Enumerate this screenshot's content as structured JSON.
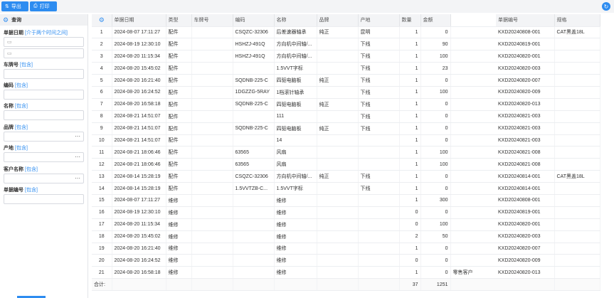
{
  "toolbar": {
    "export_label": "导出",
    "print_label": "打印"
  },
  "filter": {
    "title": "查询",
    "date_label": "单据日期",
    "date_hint": "[介于两个时间之间]",
    "plate_label": "车牌号",
    "plate_hint": "[包含]",
    "code_label": "编码",
    "code_hint": "[包含]",
    "name_label": "名称",
    "name_hint": "[包含]",
    "brand_label": "品牌",
    "brand_hint": "[包含]",
    "origin_label": "产地",
    "origin_hint": "[包含]",
    "customer_label": "客户名称",
    "customer_hint": "[包含]",
    "docno_label": "单据编号",
    "docno_hint": "[包含]"
  },
  "table": {
    "columns": [
      "单据日期",
      "类型",
      "车牌号",
      "编码",
      "名称",
      "品牌",
      "产地",
      "数量",
      "金额",
      "",
      "单据编号",
      "规格"
    ],
    "rows": [
      [
        "1",
        "2024-08-07 17:11:27",
        "配件",
        "",
        "CSQZC-32306",
        "后差速器轴承",
        "纯正",
        "昆明",
        "1",
        "0",
        "",
        "KXD20240808-001",
        "CAT黑盖18L"
      ],
      [
        "2",
        "2024-08-19 12:30:10",
        "配件",
        "",
        "HSHZJ-491Q",
        "方向机中间轴/...",
        "",
        "下线",
        "1",
        "90",
        "",
        "KXD20240819-001",
        ""
      ],
      [
        "3",
        "2024-08-20 11:15:34",
        "配件",
        "",
        "HSHZJ-491Q",
        "方向机中间轴/...",
        "",
        "下线",
        "1",
        "100",
        "",
        "KXD20240820-001",
        ""
      ],
      [
        "4",
        "2024-08-20 15:45:02",
        "配件",
        "",
        "",
        "1.5VVT字标",
        "",
        "下线",
        "1",
        "23",
        "",
        "KXD20240820-003",
        ""
      ],
      [
        "5",
        "2024-08-20 16:21:40",
        "配件",
        "",
        "SQDNB-225-C",
        "四驱电脑板",
        "纯正",
        "下线",
        "1",
        "0",
        "",
        "KXD20240820-007",
        ""
      ],
      [
        "6",
        "2024-08-20 16:24:52",
        "配件",
        "",
        "1DGZZG-5RAY",
        "1档滚针轴承",
        "",
        "下线",
        "1",
        "100",
        "",
        "KXD20240820-009",
        ""
      ],
      [
        "7",
        "2024-08-20 16:58:18",
        "配件",
        "",
        "SQDNB-225-C",
        "四驱电脑板",
        "纯正",
        "下线",
        "1",
        "0",
        "",
        "KXD20240820-013",
        ""
      ],
      [
        "8",
        "2024-08-21 14:51:07",
        "配件",
        "",
        "",
        "111",
        "",
        "下线",
        "1",
        "0",
        "",
        "KXD20240821-003",
        ""
      ],
      [
        "9",
        "2024-08-21 14:51:07",
        "配件",
        "",
        "SQDNB-225-C",
        "四驱电脑板",
        "纯正",
        "下线",
        "1",
        "0",
        "",
        "KXD20240821-003",
        ""
      ],
      [
        "10",
        "2024-08-21 14:51:07",
        "配件",
        "",
        "",
        "14",
        "",
        "",
        "1",
        "0",
        "",
        "KXD20240821-003",
        ""
      ],
      [
        "11",
        "2024-08-21 18:06:46",
        "配件",
        "",
        "63565",
        "风扇",
        "",
        "",
        "1",
        "100",
        "",
        "KXD20240821-008",
        ""
      ],
      [
        "12",
        "2024-08-21 18:06:46",
        "配件",
        "",
        "63565",
        "风扇",
        "",
        "",
        "1",
        "100",
        "",
        "KXD20240821-008",
        ""
      ],
      [
        "13",
        "2024-08-14 15:28:19",
        "配件",
        "",
        "CSQZC-32306",
        "方向机中间轴/...",
        "纯正",
        "下线",
        "1",
        "0",
        "",
        "KXD20240814-001",
        "CAT黑盖18L"
      ],
      [
        "14",
        "2024-08-14 15:28:19",
        "配件",
        "",
        "1.5VVTZB-C...",
        "1.5VVT字标",
        "",
        "下线",
        "1",
        "0",
        "",
        "KXD20240814-001",
        ""
      ],
      [
        "15",
        "2024-08-07 17:11:27",
        "维修",
        "",
        "",
        "维修",
        "",
        "",
        "1",
        "300",
        "",
        "KXD20240808-001",
        ""
      ],
      [
        "16",
        "2024-08-19 12:30:10",
        "维修",
        "",
        "",
        "维修",
        "",
        "",
        "0",
        "0",
        "",
        "KXD20240819-001",
        ""
      ],
      [
        "17",
        "2024-08-20 11:15:34",
        "维修",
        "",
        "",
        "维修",
        "",
        "",
        "0",
        "100",
        "",
        "KXD20240820-001",
        ""
      ],
      [
        "18",
        "2024-08-20 15:45:02",
        "维修",
        "",
        "",
        "维修",
        "",
        "",
        "2",
        "50",
        "",
        "KXD20240820-003",
        ""
      ],
      [
        "19",
        "2024-08-20 16:21:40",
        "维修",
        "",
        "",
        "维修",
        "",
        "",
        "1",
        "0",
        "",
        "KXD20240820-007",
        ""
      ],
      [
        "20",
        "2024-08-20 16:24:52",
        "维修",
        "",
        "",
        "维修",
        "",
        "",
        "0",
        "0",
        "",
        "KXD20240820-009",
        ""
      ],
      [
        "21",
        "2024-08-20 16:58:18",
        "维修",
        "",
        "",
        "维修",
        "",
        "",
        "1",
        "0",
        "零售客户",
        "KXD20240820-013",
        ""
      ]
    ],
    "total": {
      "label": "合计:",
      "qty": "37",
      "amount": "1251"
    }
  },
  "colors": {
    "accent": "#2d8cf0",
    "header_bg": "#f3f4f6"
  }
}
